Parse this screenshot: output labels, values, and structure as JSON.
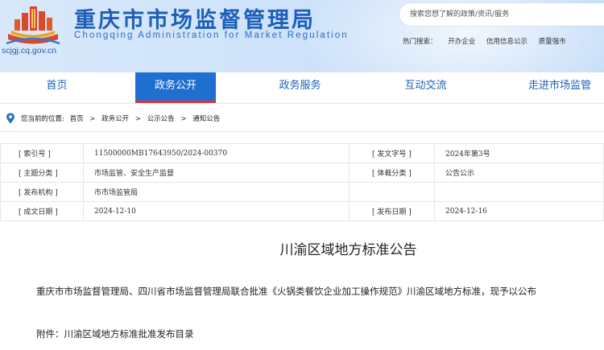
{
  "header": {
    "site_name": "重庆市市场监督管理局",
    "site_name_en": "Chongqing  Administration for Market Regulation",
    "domain": "scjgj.cq.gov.cn",
    "search_placeholder": "搜索您想了解的政策/资讯/服务",
    "hot_search_label": "热门搜索：",
    "hot_search_items": [
      "开办企业",
      "信用信息公示",
      "质量强市"
    ]
  },
  "nav": {
    "items": [
      {
        "label": "首页"
      },
      {
        "label": "政务公开"
      },
      {
        "label": "政务服务"
      },
      {
        "label": "互动交流"
      },
      {
        "label": "走进市场监管"
      }
    ],
    "active_index": 1
  },
  "breadcrumb": {
    "prefix": "您当前的位置:",
    "items": [
      "首页",
      "政务公开",
      "公示公告",
      "通知公告"
    ],
    "separator": ">"
  },
  "meta": {
    "rows": [
      {
        "label1": "[ 索引号 ]",
        "value1": "11500000MB17643950/2024-00370",
        "label2": "[ 发文字号 ]",
        "value2": "2024年第3号"
      },
      {
        "label1": "[ 主题分类 ]",
        "value1": "市场监管、安全生产监督",
        "label2": "[ 体裁分类 ]",
        "value2": "公告公示"
      },
      {
        "label1": "[ 发布机构 ]",
        "value1": "市市场监管局",
        "label2": "",
        "value2": ""
      },
      {
        "label1": "[ 成文日期 ]",
        "value1": "2024-12-10",
        "label2": "[ 发布日期 ]",
        "value2": "2024-12-16"
      }
    ]
  },
  "article": {
    "title": "川渝区域地方标准公告",
    "paragraph": "重庆市市场监督管理局、四川省市场监督管理局联合批准《火锅类餐饮企业加工操作规范》川渝区域地方标准，现予以公布",
    "attachment": "附件：川渝区域地方标准批准发布目录"
  },
  "colors": {
    "brand_blue": "#1d5fb8",
    "nav_active_bg": "#1f6fd1",
    "nav_active_underline": "#e03030"
  }
}
